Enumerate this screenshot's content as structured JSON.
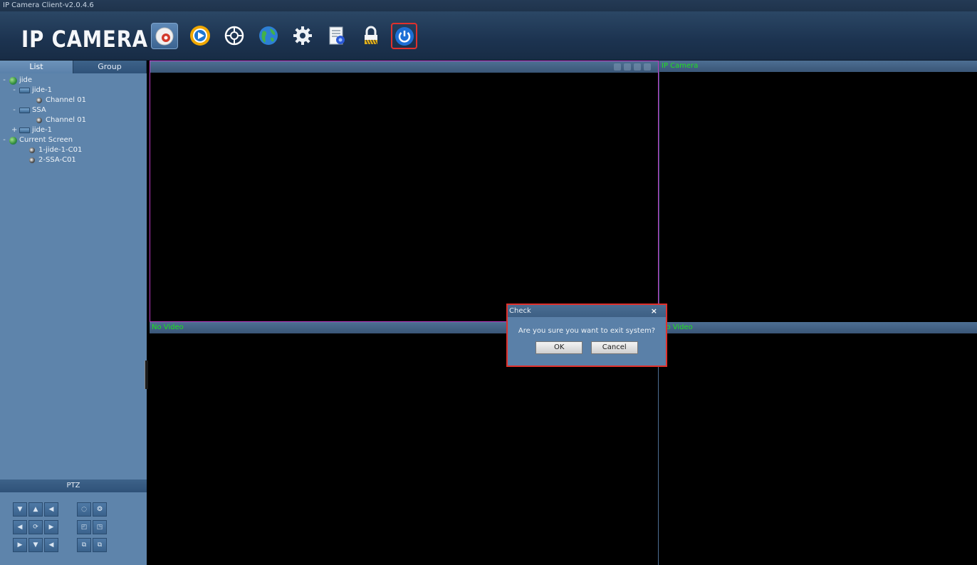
{
  "window": {
    "title": "IP Camera Client-v2.0.4.6"
  },
  "header": {
    "logo": "IP CAMERA",
    "tools": [
      {
        "icon": "camera-icon"
      },
      {
        "icon": "playback-icon"
      },
      {
        "icon": "ptz-wheel-icon"
      },
      {
        "icon": "globe-icon"
      },
      {
        "icon": "settings-gear-icon"
      },
      {
        "icon": "log-document-icon"
      },
      {
        "icon": "lock-icon"
      },
      {
        "icon": "power-icon"
      }
    ]
  },
  "sidebar": {
    "tabs": [
      {
        "label": "List"
      },
      {
        "label": "Group"
      }
    ],
    "tree": [
      {
        "sign": "-",
        "type": "group",
        "label": "jide"
      },
      {
        "sign": "-",
        "type": "device",
        "label": "jide-1"
      },
      {
        "sign": "",
        "type": "channel",
        "label": "Channel 01"
      },
      {
        "sign": "-",
        "type": "device",
        "label": "SSA"
      },
      {
        "sign": "",
        "type": "channel",
        "label": "Channel 01"
      },
      {
        "sign": "+",
        "type": "device",
        "label": "jide-1"
      },
      {
        "sign": "-",
        "type": "group",
        "label": "Current Screen"
      },
      {
        "sign": "",
        "type": "channel",
        "label": "1-jide-1-C01"
      },
      {
        "sign": "",
        "type": "channel",
        "label": "2-SSA-C01"
      }
    ],
    "ptz": {
      "label": "PTZ"
    }
  },
  "panes": [
    {
      "title": ""
    },
    {
      "title": "IP Camera"
    },
    {
      "title": "No Video"
    },
    {
      "title": "No Video"
    }
  ],
  "dialog": {
    "title": "Check",
    "close": "×",
    "message": "Are you sure you want to exit system?",
    "ok": "OK",
    "cancel": "Cancel"
  }
}
